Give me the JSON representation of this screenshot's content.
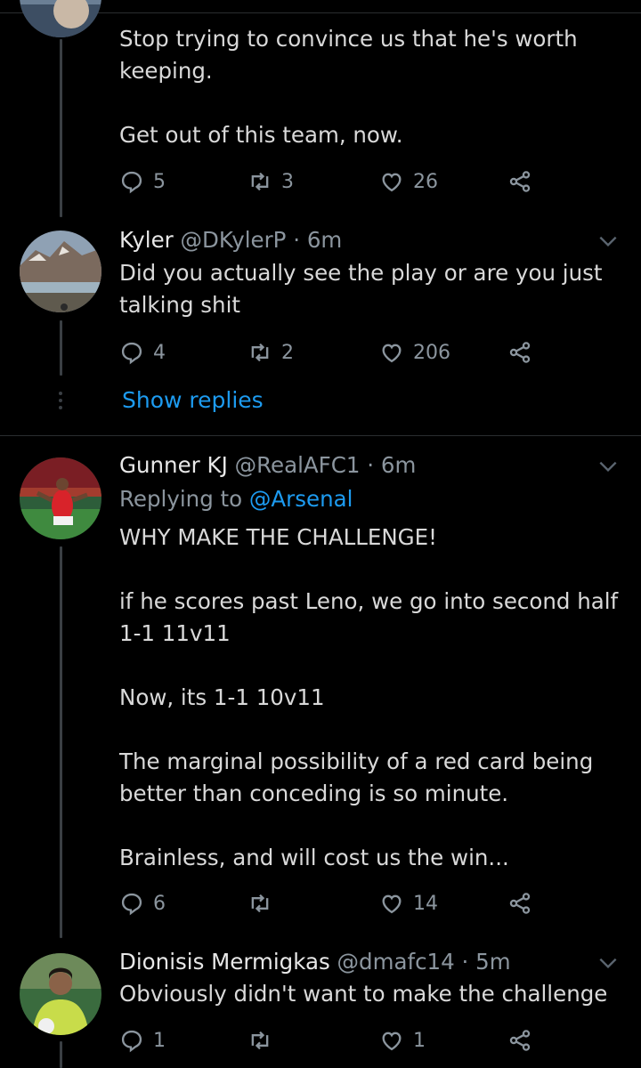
{
  "tweets": [
    {
      "body": "Stop trying to convince us that he's worth\nkeeping.\n\nGet out of this team, now.",
      "replies": "5",
      "retweets": "3",
      "likes": "26"
    },
    {
      "name": "Kyler",
      "handle": "@DKylerP",
      "dot": "·",
      "time": "6m",
      "body": "Did you actually see the play or are you just\ntalking shit",
      "replies": "4",
      "retweets": "2",
      "likes": "206",
      "show_replies": "Show replies"
    },
    {
      "name": "Gunner KJ",
      "handle": "@RealAFC1",
      "dot": "·",
      "time": "6m",
      "replying_label": "Replying to",
      "replying_handle": "@Arsenal",
      "body": "WHY MAKE THE CHALLENGE!\n\nif he scores past Leno, we go into second half\n1-1 11v11\n\nNow, its 1-1 10v11\n\nThe marginal possibility of a red card being\nbetter than conceding is so minute.\n\nBrainless, and will cost us the win...",
      "replies": "6",
      "retweets": "",
      "likes": "14"
    },
    {
      "name": "Dionisis Mermigkas",
      "handle": "@dmafc14",
      "dot": "·",
      "time": "5m",
      "body": "Obviously didn't want to make the challenge",
      "replies": "1",
      "retweets": "",
      "likes": "1"
    }
  ],
  "icons": {
    "reply": "reply-icon",
    "retweet": "retweet-icon",
    "like": "heart-icon",
    "share": "share-icon",
    "more": "chevron-down-icon"
  },
  "colors": {
    "background": "#000000",
    "text": "#d9d9d9",
    "muted": "#8b959e",
    "link": "#1d9bf0",
    "divider": "#2a2d30"
  }
}
